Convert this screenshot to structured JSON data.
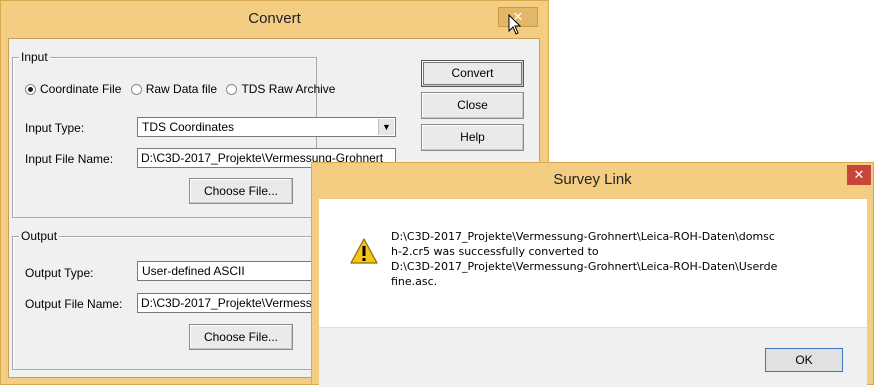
{
  "convert": {
    "title": "Convert",
    "close_glyph": "✕",
    "input": {
      "label": "Input",
      "radios": [
        {
          "label": "Coordinate File",
          "checked": true
        },
        {
          "label": "Raw Data file",
          "checked": false
        },
        {
          "label": "TDS Raw Archive",
          "checked": false
        }
      ],
      "type_label": "Input Type:",
      "type_value": "TDS Coordinates",
      "file_label": "Input File Name:",
      "file_value": "D:\\C3D-2017_Projekte\\Vermessung-Grohnert",
      "choose_label": "Choose File..."
    },
    "output": {
      "label": "Output",
      "type_label": "Output Type:",
      "type_value": "User-defined ASCII",
      "file_label": "Output File Name:",
      "file_value": "D:\\C3D-2017_Projekte\\Vermessung-Grohnert\\Leica-ROH-Daten\\Userdefine.asc",
      "choose_label": "Choose File..."
    },
    "buttons": {
      "convert": "Convert",
      "close": "Close",
      "help": "Help"
    }
  },
  "survey": {
    "title": "Survey Link",
    "close_glyph": "✕",
    "message": "D:\\C3D-2017_Projekte\\Vermessung-Grohnert\\Leica-ROH-Daten\\domsc\nh-2.cr5 was successfully converted to\nD:\\C3D-2017_Projekte\\Vermessung-Grohnert\\Leica-ROH-Daten\\Userde\nfine.asc.",
    "ok_label": "OK"
  },
  "colors": {
    "title_bar": "#f3cd82",
    "close_red": "#c7463a"
  }
}
